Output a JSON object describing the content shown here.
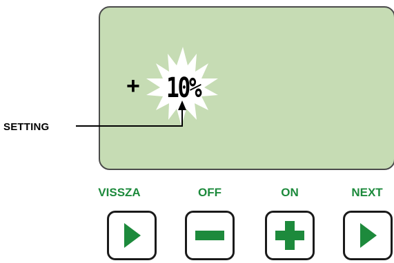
{
  "display": {
    "sign": "+",
    "value": "10%",
    "callout_label": "SETTING"
  },
  "buttons": [
    {
      "label": "VISSZA",
      "icon": "play-right-icon"
    },
    {
      "label": "OFF",
      "icon": "minus-icon"
    },
    {
      "label": "ON",
      "icon": "plus-icon"
    },
    {
      "label": "NEXT",
      "icon": "play-right-icon"
    }
  ],
  "colors": {
    "lcd_background": "#c6dcb4",
    "accent_green": "#1d8a3c",
    "text": "#000000"
  }
}
